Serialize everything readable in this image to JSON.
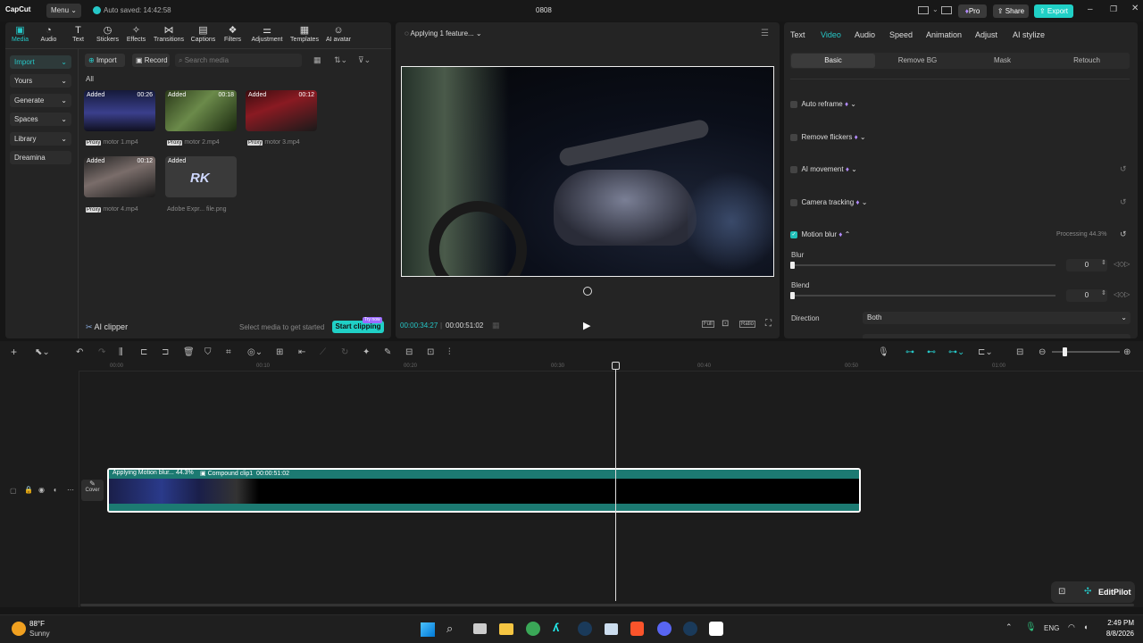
{
  "titlebar": {
    "app": "CapCut",
    "menu": "Menu",
    "autosave": "Auto saved: 14:42:58",
    "project": "0808",
    "pro": "Pro",
    "share": "Share",
    "export": "Export"
  },
  "toolbar": [
    {
      "icon": "media-icon",
      "label": "Media"
    },
    {
      "icon": "audio-icon",
      "label": "Audio"
    },
    {
      "icon": "text-icon",
      "label": "Text"
    },
    {
      "icon": "stickers-icon",
      "label": "Stickers"
    },
    {
      "icon": "effects-icon",
      "label": "Effects"
    },
    {
      "icon": "transitions-icon",
      "label": "Transitions"
    },
    {
      "icon": "captions-icon",
      "label": "Captions"
    },
    {
      "icon": "filters-icon",
      "label": "Filters"
    },
    {
      "icon": "adjustment-icon",
      "label": "Adjustment"
    },
    {
      "icon": "templates-icon",
      "label": "Templates"
    },
    {
      "icon": "ai-avatar-icon",
      "label": "AI avatar"
    }
  ],
  "sidebar": [
    {
      "label": "Import"
    },
    {
      "label": "Yours"
    },
    {
      "label": "Generate"
    },
    {
      "label": "Spaces"
    },
    {
      "label": "Library"
    },
    {
      "label": "Dreamina"
    }
  ],
  "media": {
    "import": "Import",
    "record": "Record",
    "search_placeholder": "Search media",
    "filter_all": "All",
    "items": [
      {
        "tag": "Added",
        "dur": "00:26",
        "proxy": "Proxy",
        "name": "motor 1.mp4"
      },
      {
        "tag": "Added",
        "dur": "00:18",
        "proxy": "Proxy",
        "name": "motor 2.mp4"
      },
      {
        "tag": "Added",
        "dur": "00:12",
        "proxy": "Proxy",
        "name": "motor 3.mp4"
      },
      {
        "tag": "Added",
        "dur": "00:12",
        "proxy": "Proxy",
        "name": "motor 4.mp4"
      },
      {
        "tag": "Added",
        "dur": "",
        "proxy": "",
        "name": "Adobe Expr... file.png"
      }
    ],
    "ai_clipper": "AI clipper",
    "hint": "Select media to get started",
    "start": "Start clipping",
    "try_now": "Try now"
  },
  "player": {
    "status": "Applying 1 feature...",
    "current": "00:00:34:27",
    "total": "00:00:51:02",
    "full": "Full",
    "ratio": "Ratio"
  },
  "right": {
    "tabs": [
      "Text",
      "Video",
      "Audio",
      "Speed",
      "Animation",
      "Adjust",
      "AI stylize"
    ],
    "subtabs": [
      "Basic",
      "Remove BG",
      "Mask",
      "Retouch"
    ],
    "rows": [
      {
        "label": "Auto reframe",
        "checked": false,
        "status": ""
      },
      {
        "label": "Remove flickers",
        "checked": false,
        "status": ""
      },
      {
        "label": "AI movement",
        "checked": false,
        "status": ""
      },
      {
        "label": "Camera tracking",
        "checked": false,
        "status": ""
      },
      {
        "label": "Motion blur",
        "checked": true,
        "status": "Processing 44.3%"
      }
    ],
    "blur_label": "Blur",
    "blur_value": "0",
    "blend_label": "Blend",
    "blend_value": "0",
    "direction_label": "Direction",
    "direction_value": "Both"
  },
  "timeline": {
    "ticks": [
      "00:00",
      "00:10",
      "00:20",
      "00:30",
      "00:40",
      "00:50",
      "01:00"
    ],
    "cover": "Cover",
    "clip_status": "Applying Motion blur... 44.3%",
    "clip_name": "Compound clip1",
    "clip_dur": "00:00:51:02"
  },
  "editpilot": "EditPilot",
  "taskbar": {
    "temp": "88°F",
    "weather": "Sunny",
    "lang": "ENG",
    "time": "2:49 PM",
    "date": "8/8/2026"
  }
}
